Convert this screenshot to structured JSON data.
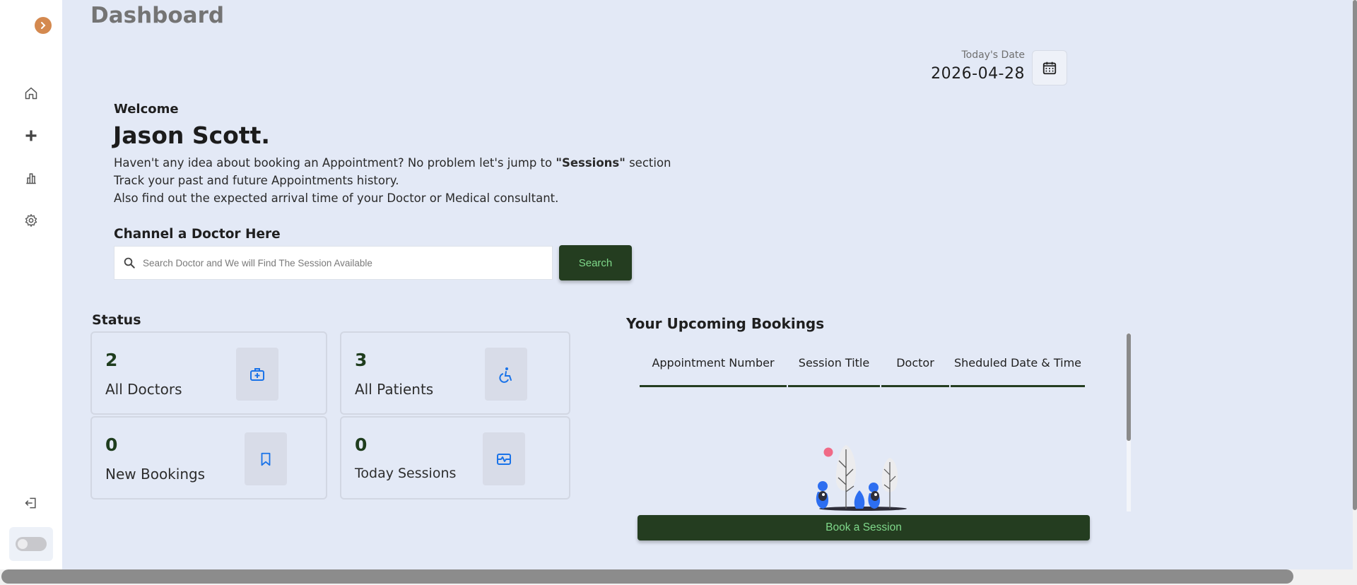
{
  "colors": {
    "background": "#e3e9f6",
    "primary_button": "#243d20",
    "button_text": "#7fd88a",
    "accent_orange": "#d4894f",
    "icon_blue": "#1a73e8"
  },
  "sidebar": {
    "items": [
      {
        "icon": "home-icon"
      },
      {
        "icon": "plus-icon"
      },
      {
        "icon": "bar-chart-icon"
      },
      {
        "icon": "gear-icon"
      }
    ],
    "logout_icon": "logout-icon",
    "theme_toggle": {
      "state": "off"
    }
  },
  "header": {
    "title": "Dashboard",
    "date_label": "Today's Date",
    "date_value": "2026-04-28"
  },
  "welcome": {
    "greeting": "Welcome",
    "user_name": "Jason Scott.",
    "line1_pre": "Haven't any idea about booking an Appointment? No problem let's jump to ",
    "line1_bold": "\"Sessions\"",
    "line1_post": " section",
    "line2": "Track your past and future Appointments history.",
    "line3": "Also find out the expected arrival time of your Doctor or Medical consultant."
  },
  "channel": {
    "title": "Channel a Doctor Here",
    "search_placeholder": "Search Doctor and We will Find The Session Available",
    "search_value": "",
    "search_button": "Search"
  },
  "status": {
    "title": "Status",
    "cards": [
      {
        "value": "2",
        "label": "All Doctors",
        "icon": "medical-kit-icon"
      },
      {
        "value": "3",
        "label": "All Patients",
        "icon": "accessible-icon"
      },
      {
        "value": "0",
        "label": "New Bookings",
        "icon": "bookmark-icon"
      },
      {
        "value": "0",
        "label": "Today Sessions",
        "icon": "heartbeat-icon"
      }
    ]
  },
  "bookings": {
    "title": "Your Upcoming Bookings",
    "columns": [
      "Appointment Number",
      "Session Title",
      "Doctor",
      "Sheduled Date & Time"
    ],
    "rows": [],
    "book_button": "Book a Session"
  }
}
